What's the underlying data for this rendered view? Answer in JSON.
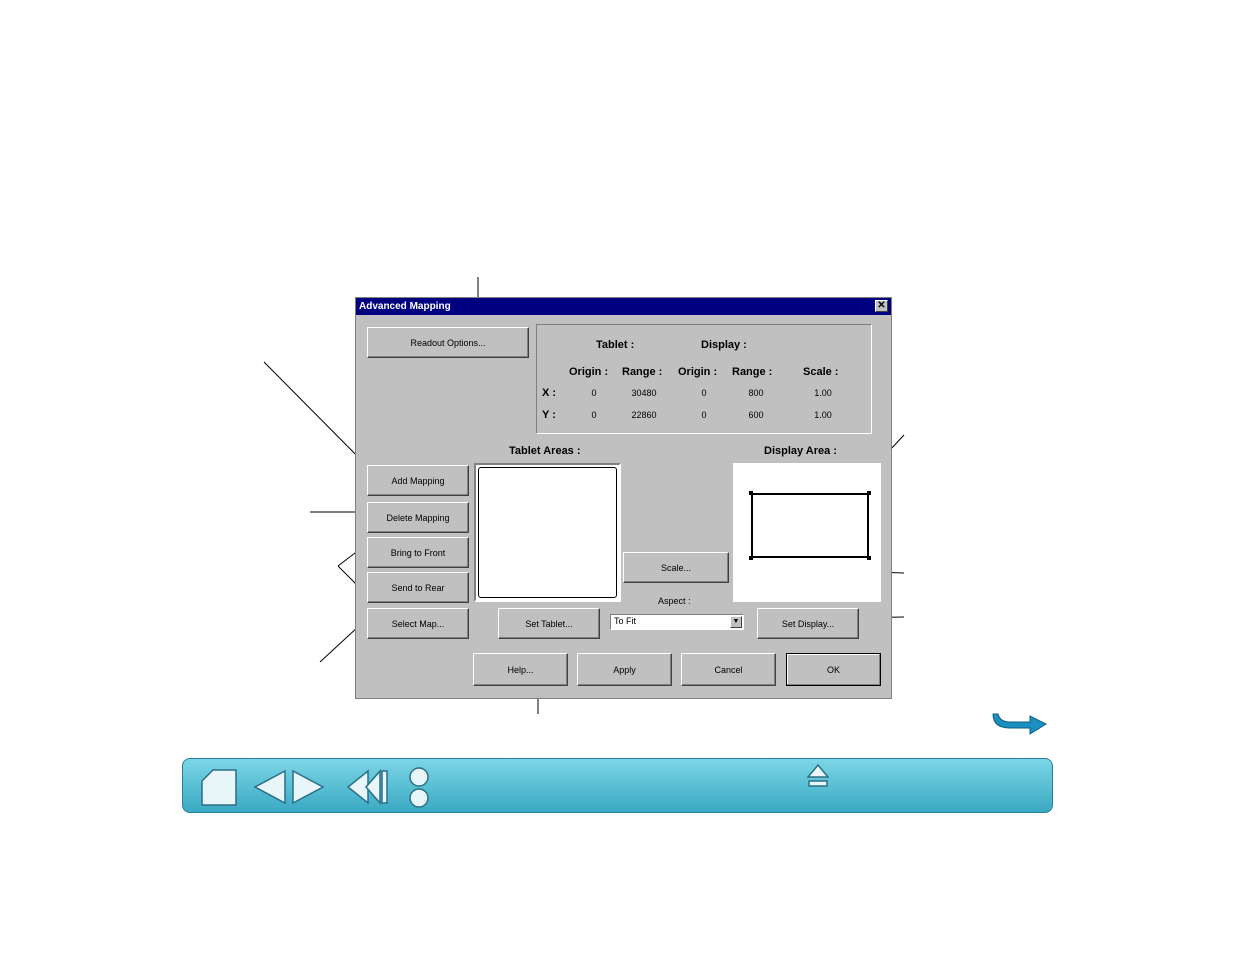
{
  "dialog": {
    "title": "Advanced Mapping",
    "close_label": "✕",
    "readout_button": "Readout Options...",
    "readout": {
      "tablet_header": "Tablet :",
      "display_header": "Display :",
      "origin_label": "Origin :",
      "range_label": "Range :",
      "scale_label": "Scale :",
      "x_label": "X :",
      "y_label": "Y :",
      "x": {
        "tablet_origin": "0",
        "tablet_range": "30480",
        "display_origin": "0",
        "display_range": "800",
        "scale": "1.00"
      },
      "y": {
        "tablet_origin": "0",
        "tablet_range": "22860",
        "display_origin": "0",
        "display_range": "600",
        "scale": "1.00"
      }
    },
    "tablet_areas_label": "Tablet Areas :",
    "display_area_label": "Display Area :",
    "buttons": {
      "add_mapping": "Add Mapping",
      "delete_mapping": "Delete Mapping",
      "bring_to_front": "Bring to Front",
      "send_to_rear": "Send to Rear",
      "select_map": "Select Map...",
      "scale": "Scale...",
      "set_tablet": "Set Tablet...",
      "set_display": "Set Display...",
      "help": "Help...",
      "apply": "Apply",
      "cancel": "Cancel",
      "ok": "OK"
    },
    "aspect": {
      "label": "Aspect :",
      "selected": "To Fit"
    }
  },
  "colors": {
    "titlebar": "#000080",
    "dialog_bg": "#c0c0c0",
    "navbar": "#3aa9c3",
    "arrow": "#1a8fc0"
  },
  "navbar": {
    "icons": [
      "home-icon",
      "previous-page-icon",
      "next-page-icon",
      "back-icon",
      "circle-buttons-icon",
      "eject-icon"
    ]
  }
}
